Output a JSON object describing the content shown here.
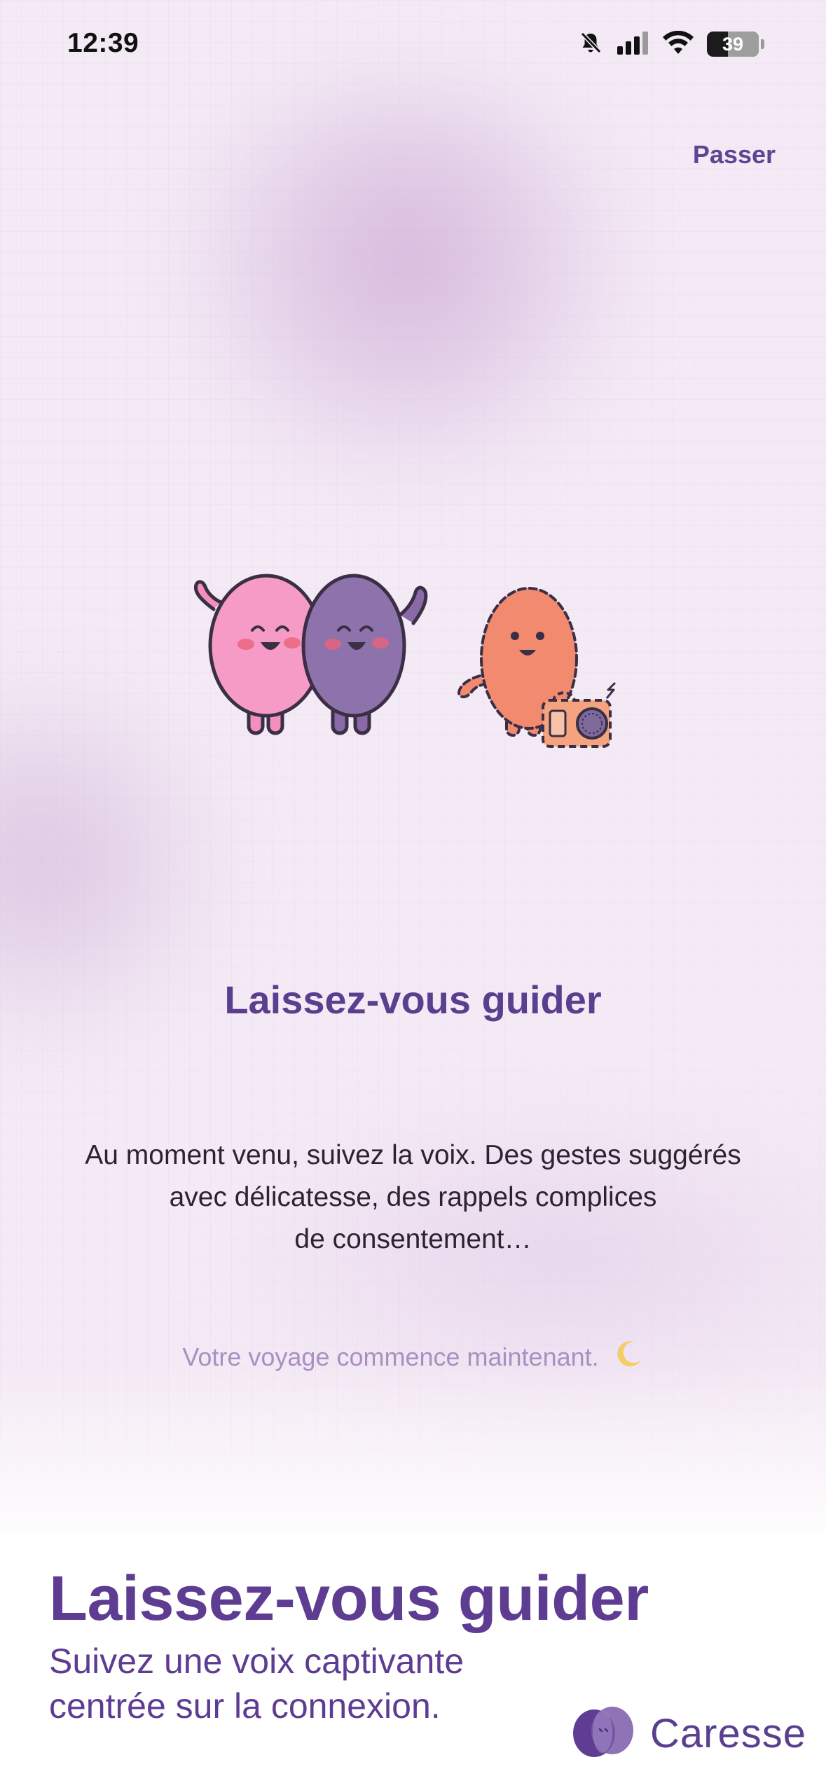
{
  "status_bar": {
    "time": "12:39",
    "battery_level": "39"
  },
  "header": {
    "skip_label": "Passer"
  },
  "slide": {
    "title": "Laissez-vous guider",
    "body_lines": [
      "Au moment venu, suivez la voix. Des gestes suggérés",
      "avec délicatesse, des rappels complices",
      "de consentement…"
    ],
    "tagline": "Votre voyage commence maintenant."
  },
  "promo": {
    "title": "Laissez-vous guider",
    "subtitle_lines": [
      "Suivez une voix captivante",
      "centrée sur la connexion."
    ],
    "brand_name": "Caresse"
  },
  "colors": {
    "accent_purple": "#5a3f8f",
    "background": "#f4eaf5",
    "pink_character": "#f28fbd",
    "purple_character": "#8a6aa6",
    "orange_character": "#f28a6f",
    "moon": "#f5c94d"
  },
  "icons": {
    "mute": "bell-slash-icon",
    "signal": "cellular-signal-icon",
    "wifi": "wifi-icon",
    "battery": "battery-icon",
    "moon": "crescent-moon-icon",
    "logo": "caresse-logo-icon"
  }
}
